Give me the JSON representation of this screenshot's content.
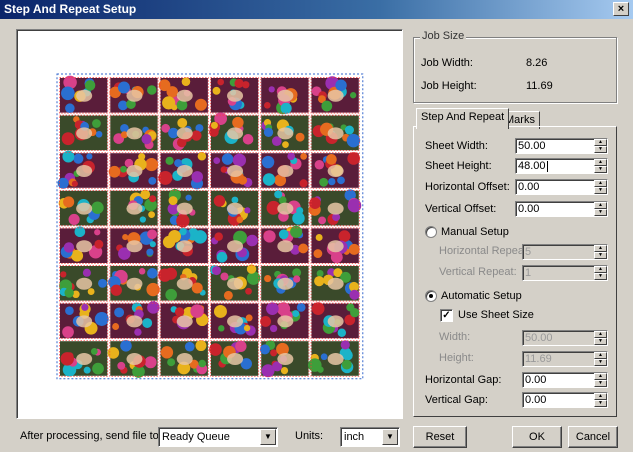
{
  "window": {
    "title": "Step And Repeat Setup",
    "close_glyph": "×"
  },
  "job_size": {
    "group_label": "Job Size",
    "width_label": "Job Width:",
    "width_value": "8.26",
    "height_label": "Job Height:",
    "height_value": "11.69"
  },
  "tabs": {
    "step_and_repeat": "Step And Repeat",
    "marks": "Marks"
  },
  "step_repeat": {
    "sheet_width_label": "Sheet Width:",
    "sheet_width": "50.00",
    "sheet_height_label": "Sheet Height:",
    "sheet_height": "48.00",
    "h_offset_label": "Horizontal Offset:",
    "h_offset": "0.00",
    "v_offset_label": "Vertical Offset:",
    "v_offset": "0.00",
    "manual_label": "Manual Setup",
    "h_repeat_label": "Horizontal Repeat:",
    "h_repeat": "5",
    "v_repeat_label": "Vertical Repeat:",
    "v_repeat": "1",
    "auto_label": "Automatic Setup",
    "use_sheet_label": "Use Sheet Size",
    "auto_width_label": "Width:",
    "auto_width": "50.00",
    "auto_height_label": "Height:",
    "auto_height": "11.69",
    "h_gap_label": "Horizontal Gap:",
    "h_gap": "0.00",
    "v_gap_label": "Vertical Gap:",
    "v_gap": "0.00"
  },
  "state": {
    "mode": "automatic",
    "use_sheet_size": true
  },
  "footer": {
    "send_label": "After processing, send file to:",
    "send_value": "Ready Queue",
    "units_label": "Units:",
    "units_value": "inch",
    "reset": "Reset",
    "ok": "OK",
    "cancel": "Cancel"
  },
  "preview": {
    "columns": 6,
    "rows": 8
  }
}
